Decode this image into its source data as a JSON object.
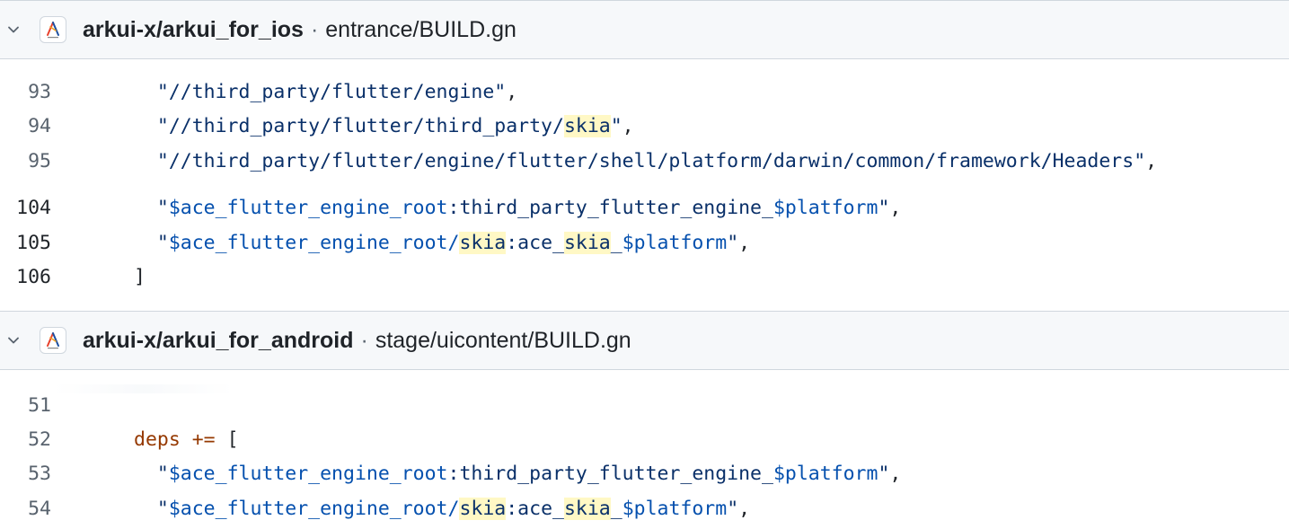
{
  "results": [
    {
      "repo": "arkui-x/arkui_for_ios",
      "separator": "·",
      "path": "entrance/BUILD.gn",
      "lines": [
        {
          "num": "93",
          "segments": [
            {
              "t": "  "
            },
            {
              "t": "\"//third_party/flutter/engine\"",
              "c": "s"
            },
            {
              "t": ","
            }
          ]
        },
        {
          "num": "94",
          "segments": [
            {
              "t": "  "
            },
            {
              "t": "\"//third_party/flutter/third_party/",
              "c": "s"
            },
            {
              "t": "skia",
              "c": "s",
              "hl": true
            },
            {
              "t": "\"",
              "c": "s"
            },
            {
              "t": ","
            }
          ]
        },
        {
          "num": "95",
          "segments": [
            {
              "t": "  "
            },
            {
              "t": "\"//third_party/flutter/engine/flutter/shell/platform/darwin/common/framework/Headers\"",
              "c": "s"
            },
            {
              "t": ","
            }
          ]
        },
        {
          "num": "104",
          "segments": [
            {
              "t": "  "
            },
            {
              "t": "\"",
              "c": "s"
            },
            {
              "t": "$ace_flutter_engine_root",
              "c": "v"
            },
            {
              "t": ":third_party_flutter_engine_",
              "c": "s"
            },
            {
              "t": "$platform",
              "c": "v"
            },
            {
              "t": "\"",
              "c": "s"
            },
            {
              "t": ","
            }
          ]
        },
        {
          "num": "105",
          "segments": [
            {
              "t": "  "
            },
            {
              "t": "\"",
              "c": "s"
            },
            {
              "t": "$ace_flutter_engine_root/",
              "c": "v"
            },
            {
              "t": "skia",
              "c": "s",
              "hl": true
            },
            {
              "t": ":ace_",
              "c": "s"
            },
            {
              "t": "skia",
              "c": "s",
              "hl": true
            },
            {
              "t": "_",
              "c": "s"
            },
            {
              "t": "$platform",
              "c": "v"
            },
            {
              "t": "\"",
              "c": "s"
            },
            {
              "t": ","
            }
          ]
        },
        {
          "num": "106",
          "segments": [
            {
              "t": "]"
            }
          ]
        }
      ]
    },
    {
      "repo": "arkui-x/arkui_for_android",
      "separator": "·",
      "path": "stage/uicontent/BUILD.gn",
      "lines": [
        {
          "num": "51",
          "segments": []
        },
        {
          "num": "52",
          "segments": [
            {
              "t": "deps",
              "c": "k"
            },
            {
              "t": " "
            },
            {
              "t": "+=",
              "c": "k"
            },
            {
              "t": " ["
            }
          ]
        },
        {
          "num": "53",
          "segments": [
            {
              "t": "  "
            },
            {
              "t": "\"",
              "c": "s"
            },
            {
              "t": "$ace_flutter_engine_root",
              "c": "v"
            },
            {
              "t": ":third_party_flutter_engine_",
              "c": "s"
            },
            {
              "t": "$platform",
              "c": "v"
            },
            {
              "t": "\"",
              "c": "s"
            },
            {
              "t": ","
            }
          ]
        },
        {
          "num": "54",
          "segments": [
            {
              "t": "  "
            },
            {
              "t": "\"",
              "c": "s"
            },
            {
              "t": "$ace_flutter_engine_root/",
              "c": "v"
            },
            {
              "t": "skia",
              "c": "s",
              "hl": true
            },
            {
              "t": ":ace_",
              "c": "s"
            },
            {
              "t": "skia",
              "c": "s",
              "hl": true
            },
            {
              "t": "_",
              "c": "s"
            },
            {
              "t": "$platform",
              "c": "v"
            },
            {
              "t": "\"",
              "c": "s"
            },
            {
              "t": ","
            }
          ]
        }
      ]
    }
  ],
  "icons": {
    "collapse": "chevron-down-icon",
    "avatar": "arkui-x-logo-icon"
  },
  "colors": {
    "header_bg": "#f6f8fa",
    "border": "#d0d7de",
    "match_highlight": "#fff8c5",
    "string": "#0a3069",
    "variable": "#0550ae",
    "keyword": "#953800"
  }
}
